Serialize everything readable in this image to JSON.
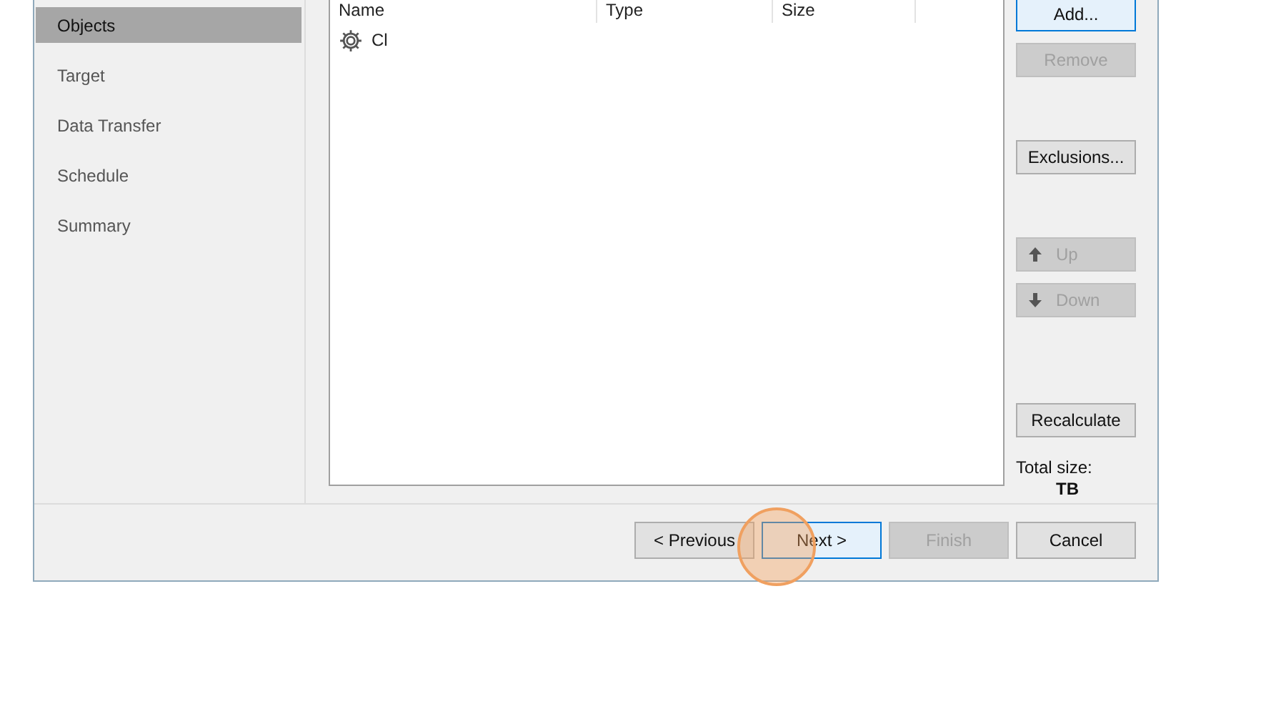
{
  "sidebar": {
    "items": [
      {
        "label": "Objects",
        "selected": true
      },
      {
        "label": "Target",
        "selected": false
      },
      {
        "label": "Data Transfer",
        "selected": false
      },
      {
        "label": "Schedule",
        "selected": false
      },
      {
        "label": "Summary",
        "selected": false
      }
    ]
  },
  "objects_list": {
    "columns": [
      "Name",
      "Type",
      "Size"
    ],
    "rows": [
      {
        "name": "Cl"
      }
    ]
  },
  "side_buttons": [
    {
      "label": "Add...",
      "disabled": false,
      "focused": true
    },
    {
      "label": "Remove",
      "disabled": true,
      "focused": false
    },
    {
      "label": "Exclusions...",
      "disabled": false,
      "focused": false
    },
    {
      "label": "Up",
      "disabled": true,
      "focused": false,
      "kind": "up"
    },
    {
      "label": "Down",
      "disabled": true,
      "focused": false,
      "kind": "down"
    },
    {
      "label": "Recalculate",
      "disabled": false,
      "focused": false
    }
  ],
  "total_size": {
    "label": "Total size:",
    "value": "TB"
  },
  "footer_buttons": [
    {
      "label": "< Previous",
      "disabled": false,
      "focused": false
    },
    {
      "label": "Next >",
      "disabled": false,
      "focused": true
    },
    {
      "label": "Finish",
      "disabled": true,
      "focused": false
    },
    {
      "label": "Cancel",
      "disabled": false,
      "focused": false
    }
  ],
  "click_indicator": true
}
